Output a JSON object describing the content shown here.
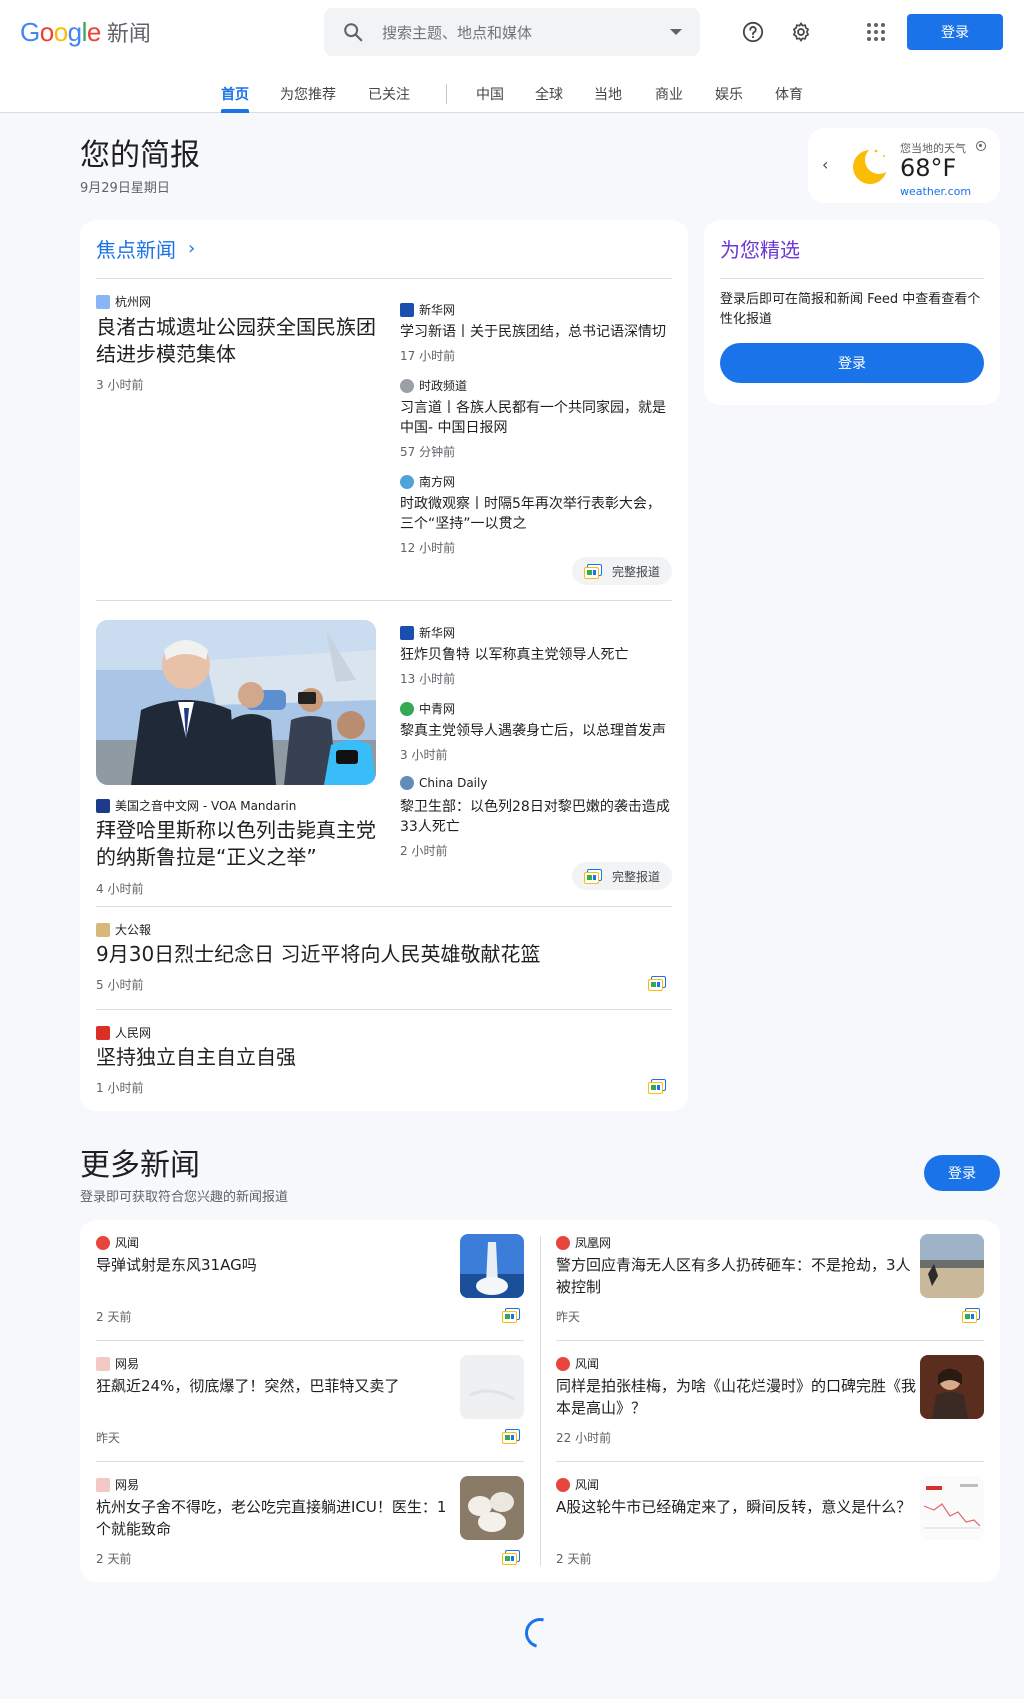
{
  "header": {
    "logo_text": "Google",
    "logo_suffix": "新闻",
    "search_placeholder": "搜索主题、地点和媒体",
    "signin": "登录",
    "icons": [
      "search-icon",
      "help-icon",
      "settings-icon",
      "apps-grid-icon"
    ]
  },
  "tabs": [
    "首页",
    "为您推荐",
    "已关注",
    "中国",
    "全球",
    "当地",
    "商业",
    "娱乐",
    "体育"
  ],
  "briefing": {
    "title": "您的简报",
    "date": "9月29日星期日"
  },
  "weather": {
    "label": "您当地的天气",
    "temp": "68°F",
    "source": "weather.com"
  },
  "top_stories": {
    "title": "焦点新闻",
    "cluster1": {
      "main": {
        "publisher": "杭州网",
        "headline": "良渚古城遗址公园获全国民族团结进步模范集体",
        "time": "3 小时前"
      },
      "side": [
        {
          "publisher": "新华网",
          "headline": "学习新语丨关于民族团结，总书记语深情切",
          "time": "17 小时前"
        },
        {
          "publisher": "时政频道",
          "headline": "习言道丨各族人民都有一个共同家园，就是中国- 中国日报网",
          "time": "57 分钟前"
        },
        {
          "publisher": "南方网",
          "headline": "时政微观察丨时隔5年再次举行表彰大会，三个“坚持”一以贯之",
          "time": "12 小时前"
        }
      ],
      "full_coverage": "完整报道"
    },
    "cluster2": {
      "main": {
        "publisher": "美国之音中文网 - VOA Mandarin",
        "headline": "拜登哈里斯称以色列击毙真主党的纳斯鲁拉是“正义之举”",
        "time": "4 小时前"
      },
      "side": [
        {
          "publisher": "新华网",
          "headline": "狂炸贝鲁特 以军称真主党领导人死亡",
          "time": "13 小时前"
        },
        {
          "publisher": "中青网",
          "headline": "黎真主党领导人遇袭身亡后，以总理首发声",
          "time": "3 小时前"
        },
        {
          "publisher": "China Daily",
          "headline": "黎卫生部：以色列28日对黎巴嫩的袭击造成33人死亡",
          "time": "2 小时前"
        }
      ],
      "full_coverage": "完整报道"
    },
    "singles": [
      {
        "publisher": "大公報",
        "headline": "9月30日烈士纪念日 习近平将向人民英雄敬献花篮",
        "time": "5 小时前"
      },
      {
        "publisher": "人民网",
        "headline": "坚持独立自主自立自强",
        "time": "1 小时前"
      }
    ]
  },
  "for_you": {
    "title": "为您精选",
    "text": "登录后即可在简报和新闻 Feed 中查看查看个性化报道",
    "button": "登录"
  },
  "more_news": {
    "title": "更多新闻",
    "subtitle": "登录即可获取符合您兴趣的新闻报道",
    "button": "登录",
    "items": [
      {
        "publisher": "风闻",
        "headline": "导弹试射是东风31AG吗",
        "time": "2 天前"
      },
      {
        "publisher": "凤凰网",
        "headline": "警方回应青海无人区有多人扔砖砸车：不是抢劫，3人被控制",
        "time": "昨天"
      },
      {
        "publisher": "网易",
        "headline": "狂飙近24%，彻底爆了！突然，巴菲特又卖了",
        "time": "昨天"
      },
      {
        "publisher": "风闻",
        "headline": "同样是拍张桂梅，为啥《山花烂漫时》的口碑完胜《我本是高山》？",
        "time": "22 小时前"
      },
      {
        "publisher": "网易",
        "headline": "杭州女子舍不得吃，老公吃完直接躺进ICU！医生：1个就能致命",
        "time": "2 天前"
      },
      {
        "publisher": "风闻",
        "headline": "A股这轮牛市已经确定来了，瞬间反转，意义是什么？",
        "time": "2 天前"
      }
    ]
  },
  "colors": {
    "accent": "#1a73e8",
    "for_you": "#6b38d4"
  }
}
